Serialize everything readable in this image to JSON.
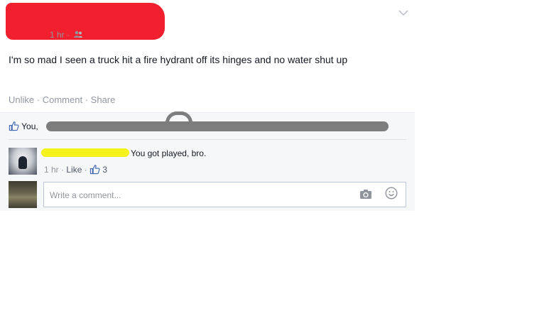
{
  "post": {
    "time": "1 hr",
    "separator": "·",
    "audience_icon": "friends-icon",
    "menu_icon": "chevron-down-icon",
    "text": "I'm so mad I seen a truck hit a fire hydrant off its hinges and no water shut up",
    "actions": {
      "unlike": "Unlike",
      "comment": "Comment",
      "share": "Share",
      "sep": "·"
    }
  },
  "likes": {
    "icon": "thumbs-up-icon",
    "label": "You,"
  },
  "comment": {
    "text": "You got played, bro.",
    "time": "1 hr",
    "sep": "·",
    "like_label": "Like",
    "like_count": "3"
  },
  "composer": {
    "placeholder": "Write a comment...",
    "camera_icon": "camera-icon",
    "emoji_icon": "smiley-icon"
  },
  "colors": {
    "link": "#4e5665",
    "meta": "#90949c",
    "facebook_blue": "#4267b2",
    "redact_red": "#f21f2e",
    "redact_gray": "#7d7d7d",
    "redact_yellow": "#f4f21a"
  }
}
